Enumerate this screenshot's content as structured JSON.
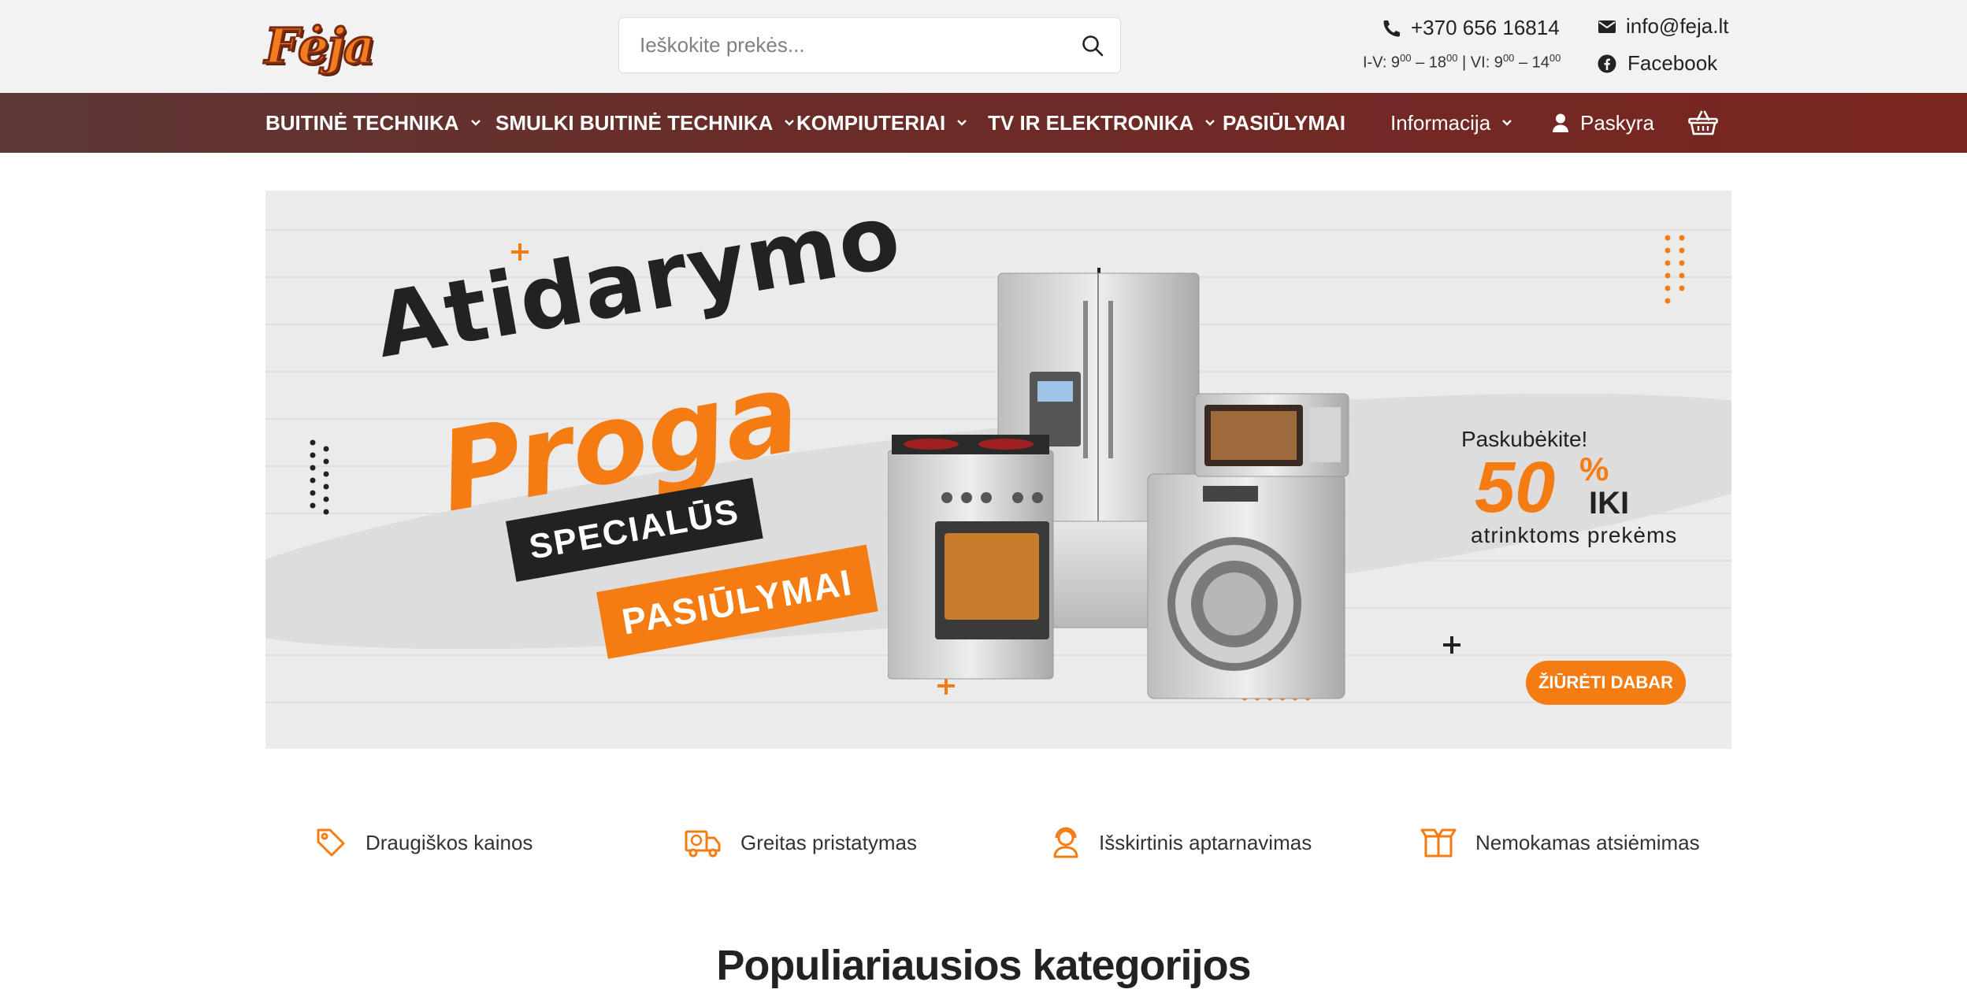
{
  "header": {
    "logo_text": "Fėja",
    "search_placeholder": "Ieškokite prekės...",
    "phone": "+370 656 16814",
    "hours_weekday_label": "I-V: 9",
    "hours_weekday_sup1": "00",
    "hours_weekday_mid": " – 18",
    "hours_weekday_sup2": "00",
    "hours_sep": " | VI: 9",
    "hours_sat_sup1": "00",
    "hours_sat_mid": " – 14",
    "hours_sat_sup2": "00",
    "email": "info@feja.lt",
    "facebook": "Facebook"
  },
  "nav": {
    "items": [
      {
        "label": "BUITINĖ TECHNIKA"
      },
      {
        "label": "SMULKI BUITINĖ TECHNIKA"
      },
      {
        "label": "KOMPIUTERIAI"
      },
      {
        "label": "TV IR ELEKTRONIKA"
      },
      {
        "label": "PASIŪLYMAI"
      }
    ],
    "info_label": "Informacija",
    "account_label": "Paskyra"
  },
  "banner": {
    "title": "Atidarymo",
    "subtitle": "Proga",
    "tag1": "SPECIALŪS",
    "tag2": "PASIŪLYMAI",
    "promo_lead": "Paskubėkite!",
    "promo_value": "50",
    "promo_pct": "%",
    "promo_iki": "IKI",
    "promo_note": "atrinktoms prekėms",
    "button": "ŽIŪRĖTI DABAR"
  },
  "features": [
    {
      "label": "Draugiškos kainos",
      "icon": "price-tag-icon"
    },
    {
      "label": "Greitas pristatymas",
      "icon": "delivery-truck-icon"
    },
    {
      "label": "Išskirtinis aptarnavimas",
      "icon": "support-icon"
    },
    {
      "label": "Nemokamas atsiėmimas",
      "icon": "box-icon"
    }
  ],
  "section": {
    "title": "Populiariausios kategorijos"
  },
  "colors": {
    "accent": "#f47c12",
    "nav_bg": "#6a2c28",
    "topbar_bg": "#f2f2f2"
  }
}
